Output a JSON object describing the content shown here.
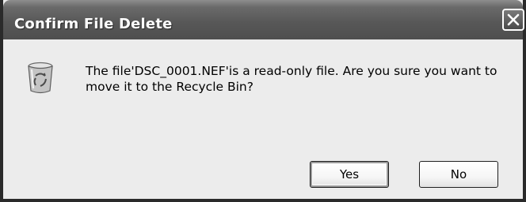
{
  "dialog": {
    "title": "Confirm File Delete",
    "message": "The file'DSC_0001.NEF'is a read-only file. Are you sure you want to move it to the Recycle Bin?",
    "icon": "recycle-bin-icon",
    "buttons": {
      "yes_label": "Yes",
      "no_label": "No"
    }
  },
  "colors": {
    "titlebar": "#5a5a5a",
    "dialog_background": "#ececec",
    "border": "#2a2a2a"
  }
}
